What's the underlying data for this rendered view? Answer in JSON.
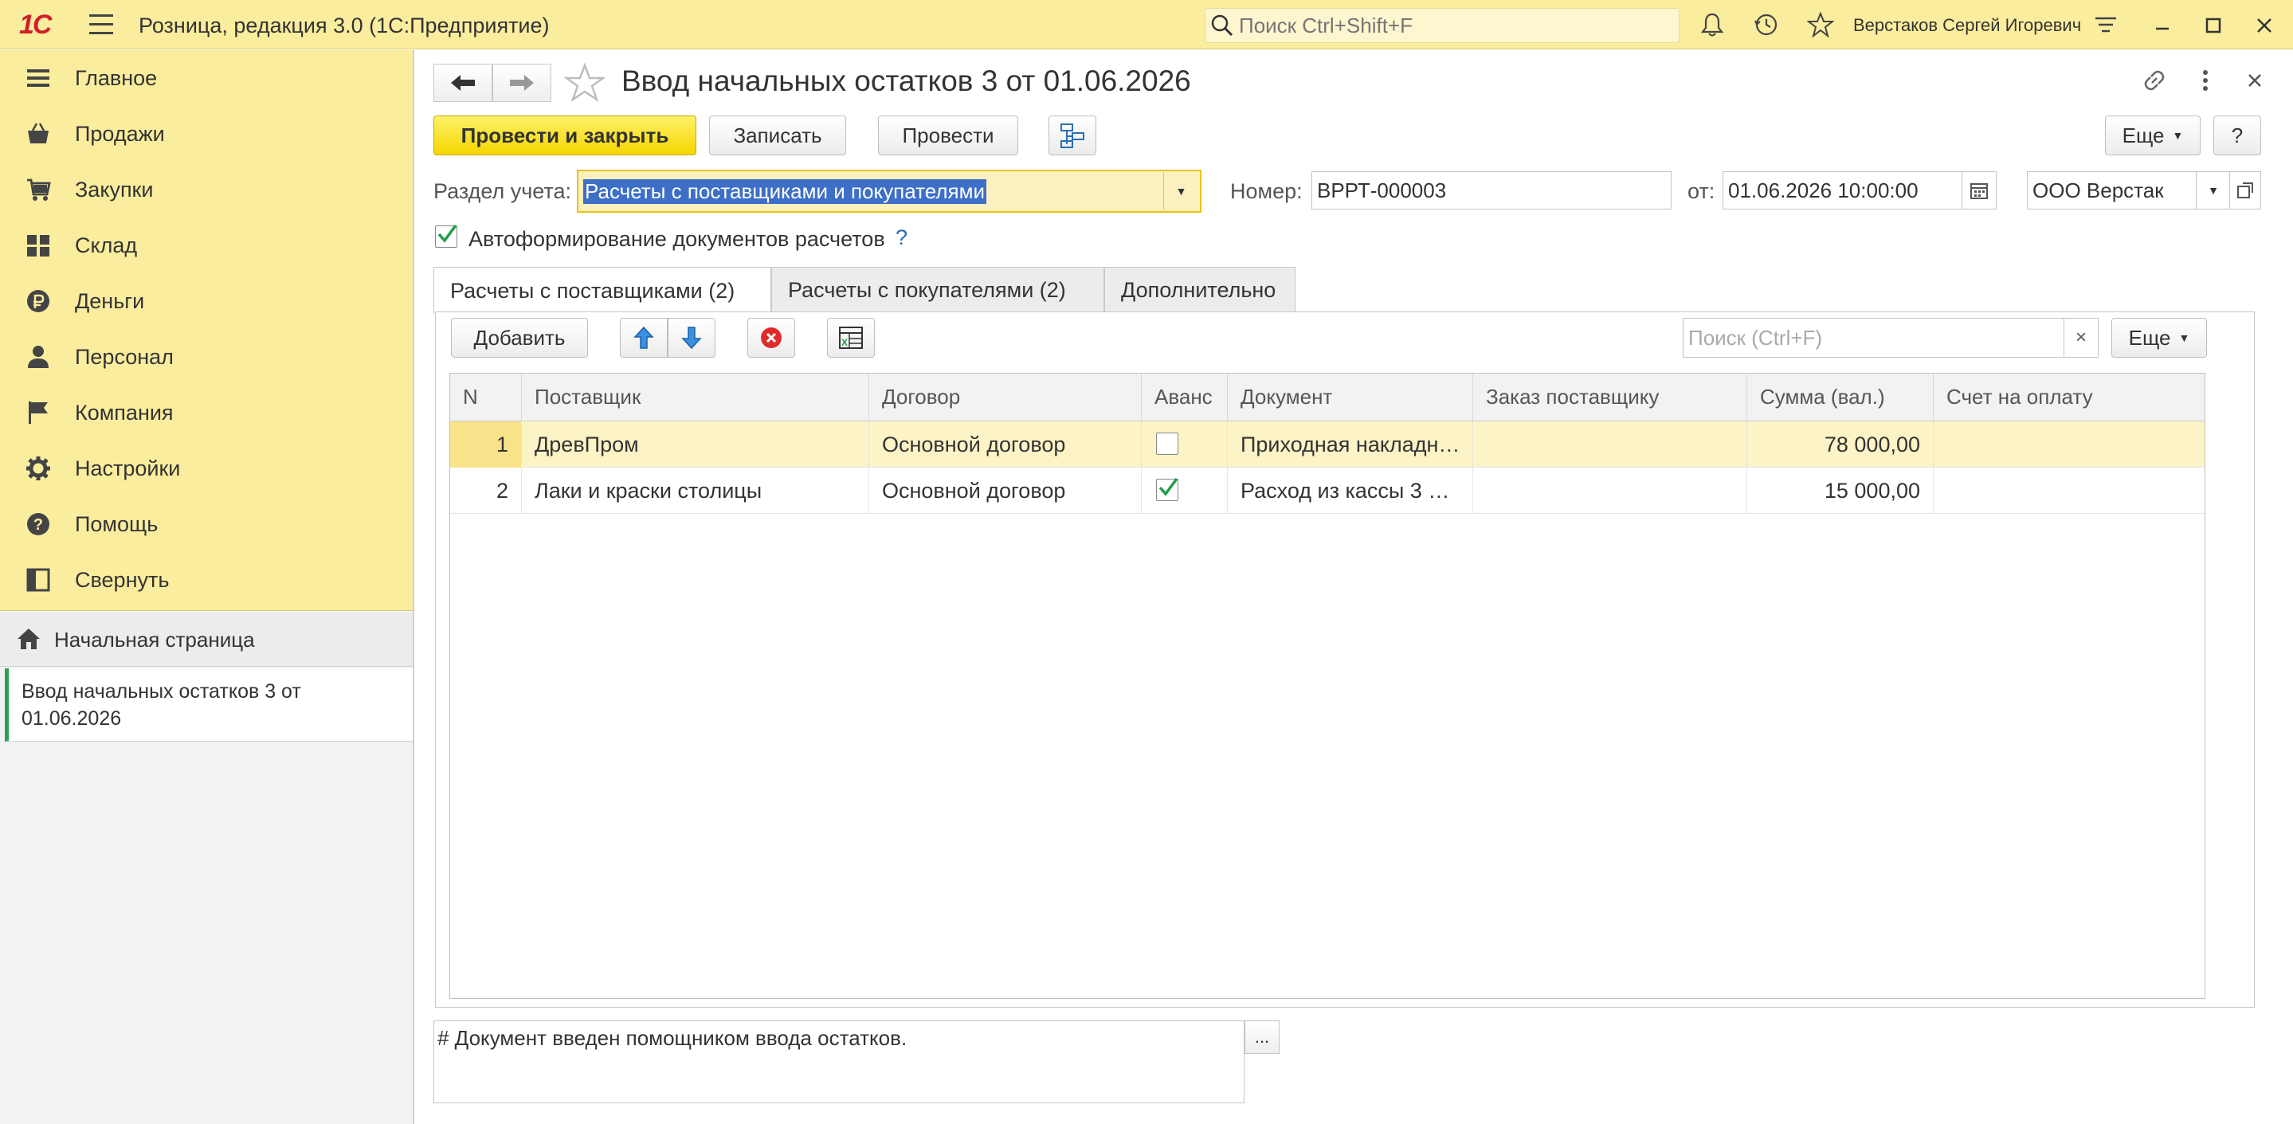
{
  "app": {
    "logo": "1С",
    "title": "Розница, редакция 3.0  (1С:Предприятие)",
    "search_placeholder": "Поиск Ctrl+Shift+F",
    "user": "Верстаков Сергей Игоревич"
  },
  "sidebar": {
    "items": [
      {
        "label": "Главное",
        "icon": "list-icon"
      },
      {
        "label": "Продажи",
        "icon": "basket-icon"
      },
      {
        "label": "Закупки",
        "icon": "cart-icon"
      },
      {
        "label": "Склад",
        "icon": "warehouse-icon"
      },
      {
        "label": "Деньги",
        "icon": "ruble-icon"
      },
      {
        "label": "Персонал",
        "icon": "person-icon"
      },
      {
        "label": "Компания",
        "icon": "flag-icon"
      },
      {
        "label": "Настройки",
        "icon": "gear-icon"
      },
      {
        "label": "Помощь",
        "icon": "help-icon"
      },
      {
        "label": "Свернуть",
        "icon": "collapse-icon"
      }
    ],
    "home": "Начальная страница",
    "open_doc": "Ввод начальных остатков 3 от 01.06.2026"
  },
  "form": {
    "title": "Ввод начальных остатков 3 от 01.06.2026",
    "buttons": {
      "post_close": "Провести и закрыть",
      "save": "Записать",
      "post": "Провести",
      "more": "Еще",
      "help": "?"
    },
    "section_label": "Раздел учета:",
    "section_value": "Расчеты с поставщиками и покупателями",
    "number_label": "Номер:",
    "number_value": "ВРРТ-000003",
    "date_label": "от:",
    "date_value": "01.06.2026 10:00:00",
    "org_value": "ООО Верстак",
    "auto_docs_label": "Автоформирование документов расчетов",
    "auto_docs_help": "?",
    "tabs": [
      "Расчеты с поставщиками (2)",
      "Расчеты с покупателями (2)",
      "Дополнительно"
    ],
    "table_toolbar": {
      "add": "Добавить",
      "search_placeholder": "Поиск (Ctrl+F)",
      "clear": "×",
      "more": "Еще"
    },
    "columns": [
      "N",
      "Поставщик",
      "Договор",
      "Аванс",
      "Документ",
      "Заказ поставщику",
      "Сумма (вал.)",
      "Счет на оплату"
    ],
    "rows": [
      {
        "n": "1",
        "supplier": "ДревПром",
        "contract": "Основной договор",
        "advance": false,
        "document": "Приходная накладн…",
        "order": "",
        "sum": "78 000,00",
        "invoice": ""
      },
      {
        "n": "2",
        "supplier": "Лаки и краски столицы",
        "contract": "Основной договор",
        "advance": true,
        "document": "Расход из кассы 3 …",
        "order": "",
        "sum": "15 000,00",
        "invoice": ""
      }
    ],
    "comment": "# Документ введен помощником ввода остатков.",
    "comment_btn": "..."
  },
  "colors": {
    "header_bg": "#fbed9e",
    "primary_btn": "#f5d600",
    "selected_row": "#fcf3c6",
    "check_green": "#1f9e4a",
    "active_doc_marker": "#2f9e57"
  }
}
